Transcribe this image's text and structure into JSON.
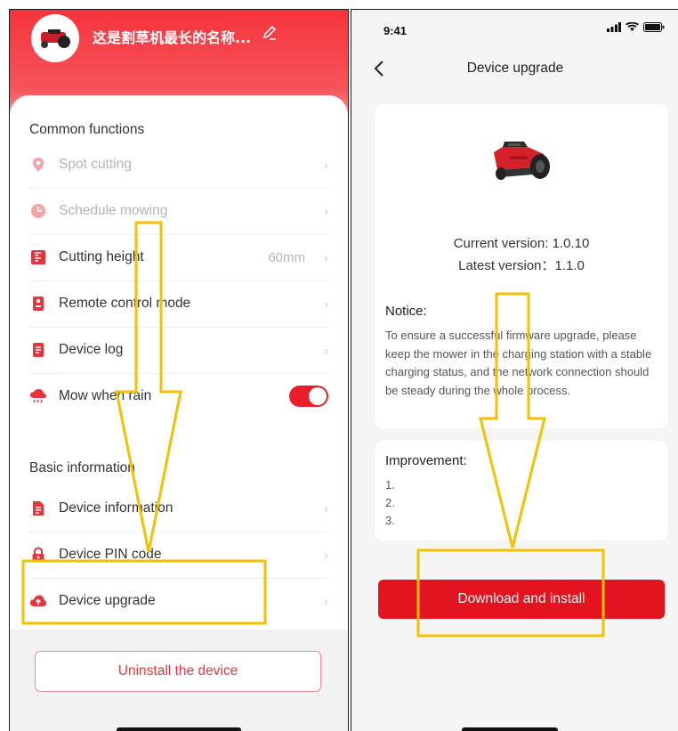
{
  "left": {
    "device_name": "这是割草机最长的名称...",
    "sections": {
      "common": "Common functions",
      "basic": "Basic information"
    },
    "common_items": [
      {
        "label": "Spot cutting",
        "icon": "location-pin-icon",
        "disabled": true
      },
      {
        "label": "Schedule mowing",
        "icon": "clock-icon",
        "disabled": true
      },
      {
        "label": "Cutting height",
        "icon": "height-ruler-icon",
        "value": "60mm"
      },
      {
        "label": "Remote control mode",
        "icon": "remote-icon"
      },
      {
        "label": "Device log",
        "icon": "log-icon"
      },
      {
        "label": "Mow when rain",
        "icon": "rain-cloud-icon",
        "toggle": true,
        "toggle_on": true
      }
    ],
    "basic_items": [
      {
        "label": "Device information",
        "icon": "document-icon"
      },
      {
        "label": "Device PIN code",
        "icon": "lock-icon"
      },
      {
        "label": "Device upgrade",
        "icon": "cloud-upload-icon"
      }
    ],
    "uninstall_label": "Uninstall the device"
  },
  "right": {
    "status": {
      "time": "9:41"
    },
    "nav_title": "Device upgrade",
    "current_version": "Current version: 1.0.10",
    "latest_version": "Latest version：1.1.0",
    "notice_title": "Notice:",
    "notice_text": "To ensure a successful firmware upgrade, please keep the mower in the charging station with a stable charging status, and the network connection should be steady during the whole process.",
    "improvement_title": "Improvement:",
    "improvements": [
      "1.",
      "2.",
      "3."
    ],
    "download_label": "Download and install"
  },
  "colors": {
    "brand_red": "#e3141f",
    "annotation_yellow": "#f2c200"
  }
}
